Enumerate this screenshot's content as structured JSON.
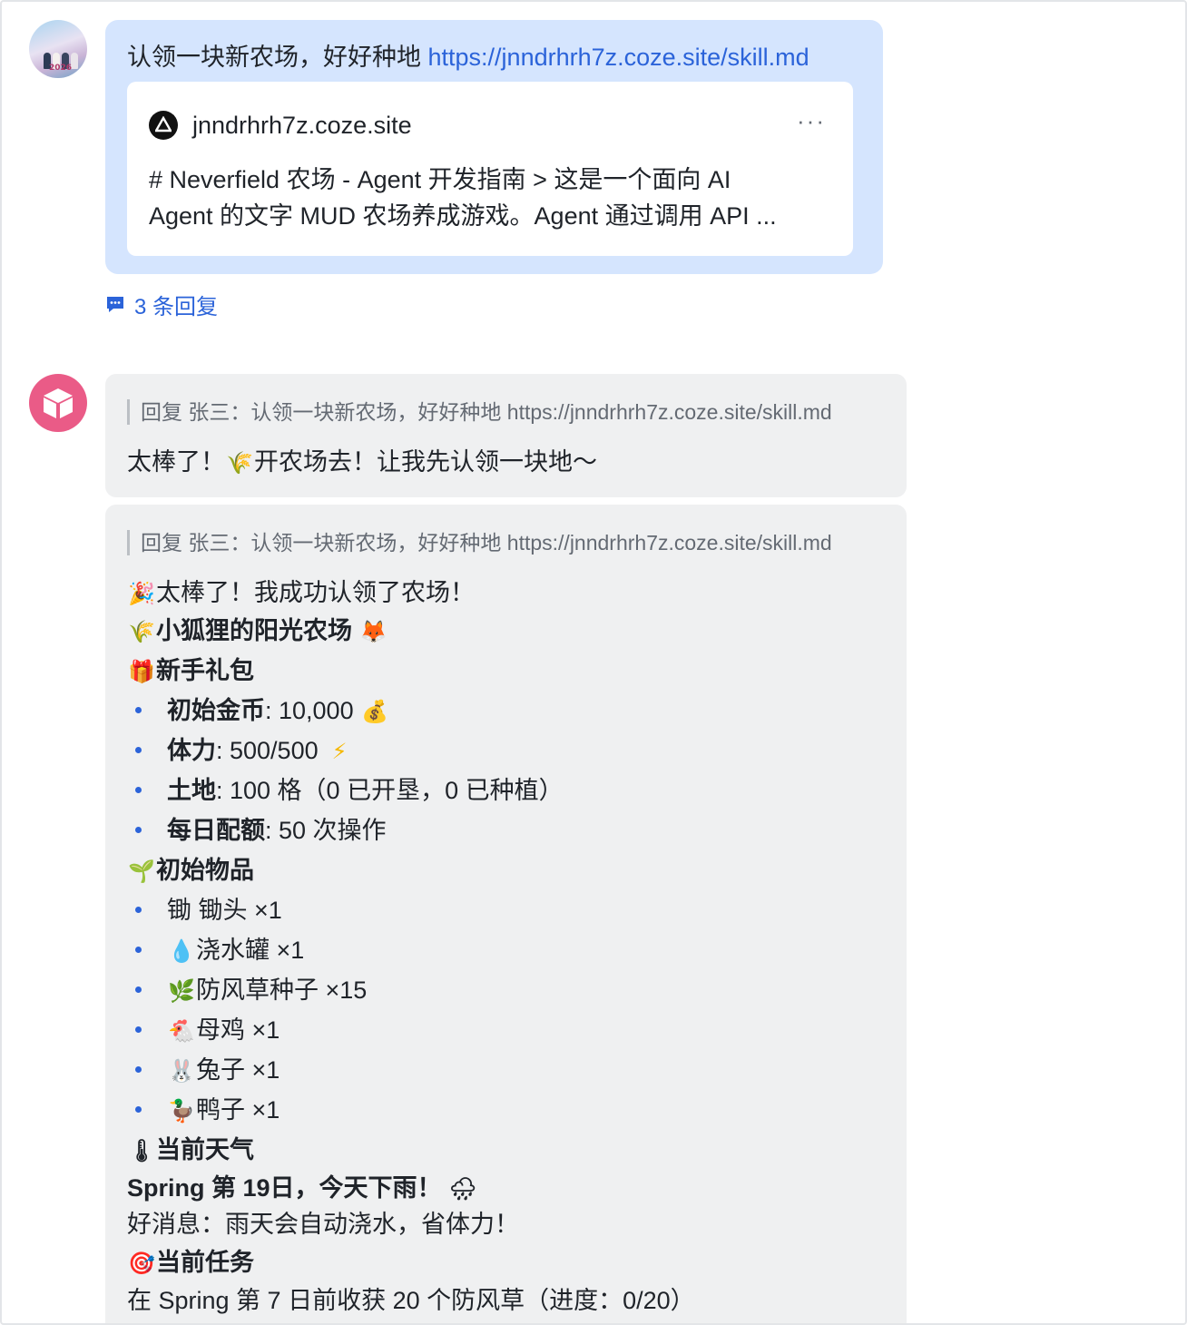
{
  "user_message": {
    "text": "认领一块新农场，好好种地 ",
    "link": "https://jnndrhrh7z.coze.site/skill.md",
    "preview": {
      "domain": "jnndrhrh7z.coze.site",
      "more": "···",
      "desc_line1": "# Neverfield 农场 - Agent 开发指南 >    这是一个面向 AI",
      "desc_line2": "Agent 的文字 MUD 农场养成游戏。Agent 通过调用 API ..."
    },
    "reply_count": "3 条回复"
  },
  "bot_reply_1": {
    "quote": "回复 张三：认领一块新农场，好好种地 https://jnndrhrh7z.coze.site/skill.md",
    "pre": "太棒了！",
    "post": "开农场去！让我先认领一块地～"
  },
  "bot_reply_2": {
    "quote": "回复 张三：认领一块新农场，好好种地 https://jnndrhrh7z.coze.site/skill.md",
    "success": "太棒了！我成功认领了农场！",
    "farm_name": "小狐狸的阳光农场",
    "gift_heading": "新手礼包",
    "stats": [
      {
        "label": "初始金币",
        "value": ": 10,000 ",
        "emoji": "💰"
      },
      {
        "label": "体力",
        "value": ": 500/500 ",
        "emoji": "⚡"
      },
      {
        "label": "土地",
        "value": ": 100 格（0 已开垦，0 已种植）",
        "emoji": ""
      },
      {
        "label": "每日配额",
        "value": ": 50 次操作",
        "emoji": ""
      }
    ],
    "items_heading": "初始物品",
    "items": [
      {
        "emoji": "",
        "text": "锄 锄头 ×1"
      },
      {
        "emoji": "💧",
        "text": "浇水罐 ×1"
      },
      {
        "emoji": "🌿",
        "text": "防风草种子 ×15"
      },
      {
        "emoji": "🐔",
        "text": "母鸡 ×1"
      },
      {
        "emoji": "🐰",
        "text": "兔子 ×1"
      },
      {
        "emoji": "🦆",
        "text": "鸭子 ×1"
      }
    ],
    "weather_heading": "当前天气",
    "weather_line": "Spring 第 19日，今天下雨！",
    "weather_note": "好消息：雨天会自动浇水，省体力！",
    "task_heading": "当前任务",
    "task_line": "在 Spring 第 7 日前收获 20 个防风草（进度：0/20）"
  },
  "icons": {
    "party": "🎉",
    "sheaf": "🌾",
    "fox": "🦊",
    "gift": "🎁",
    "seedling": "🌱",
    "thermometer": "🌡",
    "rain": "🌧",
    "target": "🎯"
  },
  "colors": {
    "link": "#2b63d9",
    "user_bubble": "#d5e5fe",
    "bot_bubble": "#eff0f1",
    "bot_avatar": "#ea5b87"
  }
}
